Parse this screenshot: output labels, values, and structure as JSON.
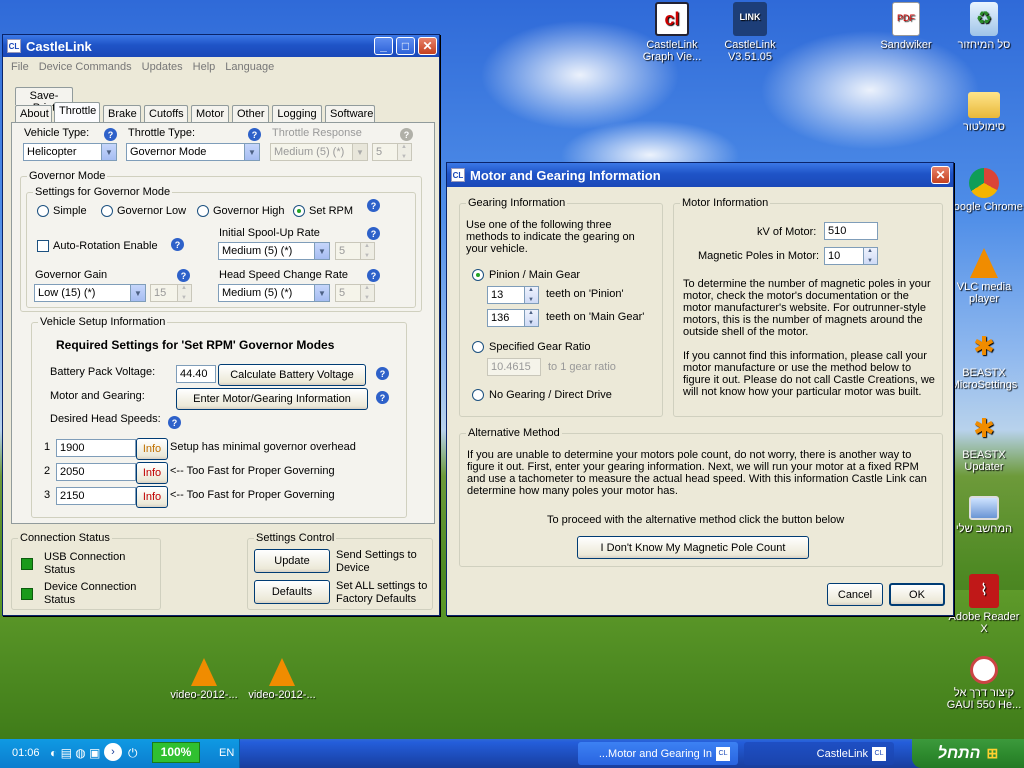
{
  "desktop": {
    "icons": [
      {
        "label": "CastleLink Graph Vie...",
        "name": "castlelink-graph-icon"
      },
      {
        "label": "CastleLink V3.51.05",
        "name": "castlelink-app-icon"
      },
      {
        "label": "Sandwiker",
        "name": "pdf-icon"
      },
      {
        "label": "סל המיחזור",
        "name": "recycle-bin-icon"
      },
      {
        "label": "סימולטור",
        "name": "folder-icon"
      },
      {
        "label": "Google Chrome",
        "name": "chrome-icon"
      },
      {
        "label": "VLC media player",
        "name": "vlc-icon"
      },
      {
        "label": "BEASTX MicroSettings",
        "name": "beastx-icon"
      },
      {
        "label": "BEASTX Updater",
        "name": "beastx-updater-icon"
      },
      {
        "label": "המחשב שלי",
        "name": "my-computer-icon"
      },
      {
        "label": "Adobe Reader X",
        "name": "adobe-reader-icon"
      },
      {
        "label": "קיצור דרך אל GAUI 550 He...",
        "name": "gaui-shortcut-icon"
      },
      {
        "label": "video-2012-...",
        "name": "video-file-icon"
      },
      {
        "label": "video-2012-...",
        "name": "video-file-icon"
      }
    ]
  },
  "castlelink": {
    "title": "CastleLink",
    "menu": [
      "File",
      "Device Commands",
      "Updates",
      "Help",
      "Language"
    ],
    "tabs_top": [
      "Save-Print"
    ],
    "tabs": [
      "About",
      "Throttle",
      "Brake",
      "Cutoffs",
      "Motor",
      "Other",
      "Logging",
      "Software"
    ],
    "vehicle_type_label": "Vehicle Type:",
    "vehicle_type_value": "Helicopter",
    "throttle_type_label": "Throttle Type:",
    "throttle_type_value": "Governor Mode",
    "throttle_response_label": "Throttle Response",
    "throttle_response_value": "Medium (5) (*)",
    "throttle_response_num": "5",
    "governor_mode_label": "Governor Mode",
    "settings_governor_label": "Settings for Governor Mode",
    "radio_simple": "Simple",
    "radio_gov_low": "Governor Low",
    "radio_gov_high": "Governor High",
    "radio_set_rpm": "Set RPM",
    "auto_rotation": "Auto-Rotation Enable",
    "initial_spool_label": "Initial Spool-Up Rate",
    "initial_spool_value": "Medium (5) (*)",
    "initial_spool_num": "5",
    "governor_gain_label": "Governor Gain",
    "governor_gain_value": "Low (15) (*)",
    "governor_gain_num": "15",
    "head_speed_label": "Head Speed Change Rate",
    "head_speed_value": "Medium (5) (*)",
    "head_speed_num": "5",
    "vehicle_setup_label": "Vehicle Setup Information",
    "required_settings": "Required Settings for 'Set RPM' Governor Modes",
    "battery_label": "Battery Pack Voltage:",
    "battery_value": "44.40",
    "calc_battery_btn": "Calculate Battery Voltage",
    "motor_gearing_label": "Motor and Gearing:",
    "enter_motor_btn": "Enter Motor/Gearing Information",
    "desired_head_label": "Desired Head Speeds:",
    "head_speeds": [
      {
        "num": "1",
        "value": "1900",
        "info": "Info",
        "note": "Setup has minimal governor overhead"
      },
      {
        "num": "2",
        "value": "2050",
        "info": "Info",
        "note": "<-- Too Fast for Proper Governing"
      },
      {
        "num": "3",
        "value": "2150",
        "info": "Info",
        "note": "<-- Too Fast for Proper Governing"
      }
    ],
    "connection_status_label": "Connection Status",
    "usb_status": "USB Connection Status",
    "device_status": "Device Connection Status",
    "settings_control_label": "Settings Control",
    "update_btn": "Update",
    "update_desc": "Send Settings to Device",
    "defaults_btn": "Defaults",
    "defaults_desc": "Set ALL settings to Factory Defaults"
  },
  "dialog": {
    "title": "Motor and Gearing Information",
    "gearing_label": "Gearing Information",
    "gearing_intro": "Use one of the following three methods to indicate the gearing on your vehicle.",
    "pinion_main": "Pinion / Main Gear",
    "pinion_value": "13",
    "pinion_suffix": "teeth on 'Pinion'",
    "main_value": "136",
    "main_suffix": "teeth on 'Main Gear'",
    "specified_ratio": "Specified Gear Ratio",
    "ratio_value": "10.4615",
    "ratio_suffix": "to 1 gear ratio",
    "no_gearing": "No Gearing / Direct Drive",
    "motor_info_label": "Motor Information",
    "kv_label": "kV of Motor:",
    "kv_value": "510",
    "poles_label": "Magnetic Poles in Motor:",
    "poles_value": "10",
    "motor_text1": "To determine the number of magnetic poles in your motor, check the motor's documentation or the motor manufacturer's website.  For outrunner-style motors, this is the number of magnets around the outside shell of the motor.",
    "motor_text2": "If you cannot find this information, please call your motor manufacture or use the method below to figure it out.  Please do not call Castle Creations, we will not know how your particular motor was built.",
    "alt_label": "Alternative Method",
    "alt_text": "If you are unable to determine your motors pole count, do not worry, there is another way to figure it out.  First, enter your gearing information.  Next, we will run your motor at a fixed RPM and use a tachometer to measure the actual head speed.  With this information Castle Link can determine how many poles your motor has.",
    "alt_proceed": "To proceed with the alternative method click the button below",
    "dont_know_btn": "I Don't Know My Magnetic Pole Count",
    "cancel_btn": "Cancel",
    "ok_btn": "OK"
  },
  "taskbar": {
    "start_label": "התחל",
    "tasks": [
      {
        "label": "CastleLink"
      },
      {
        "label": "...Motor and Gearing In"
      }
    ],
    "lang": "EN",
    "battery": "100%",
    "time": "01:06"
  }
}
